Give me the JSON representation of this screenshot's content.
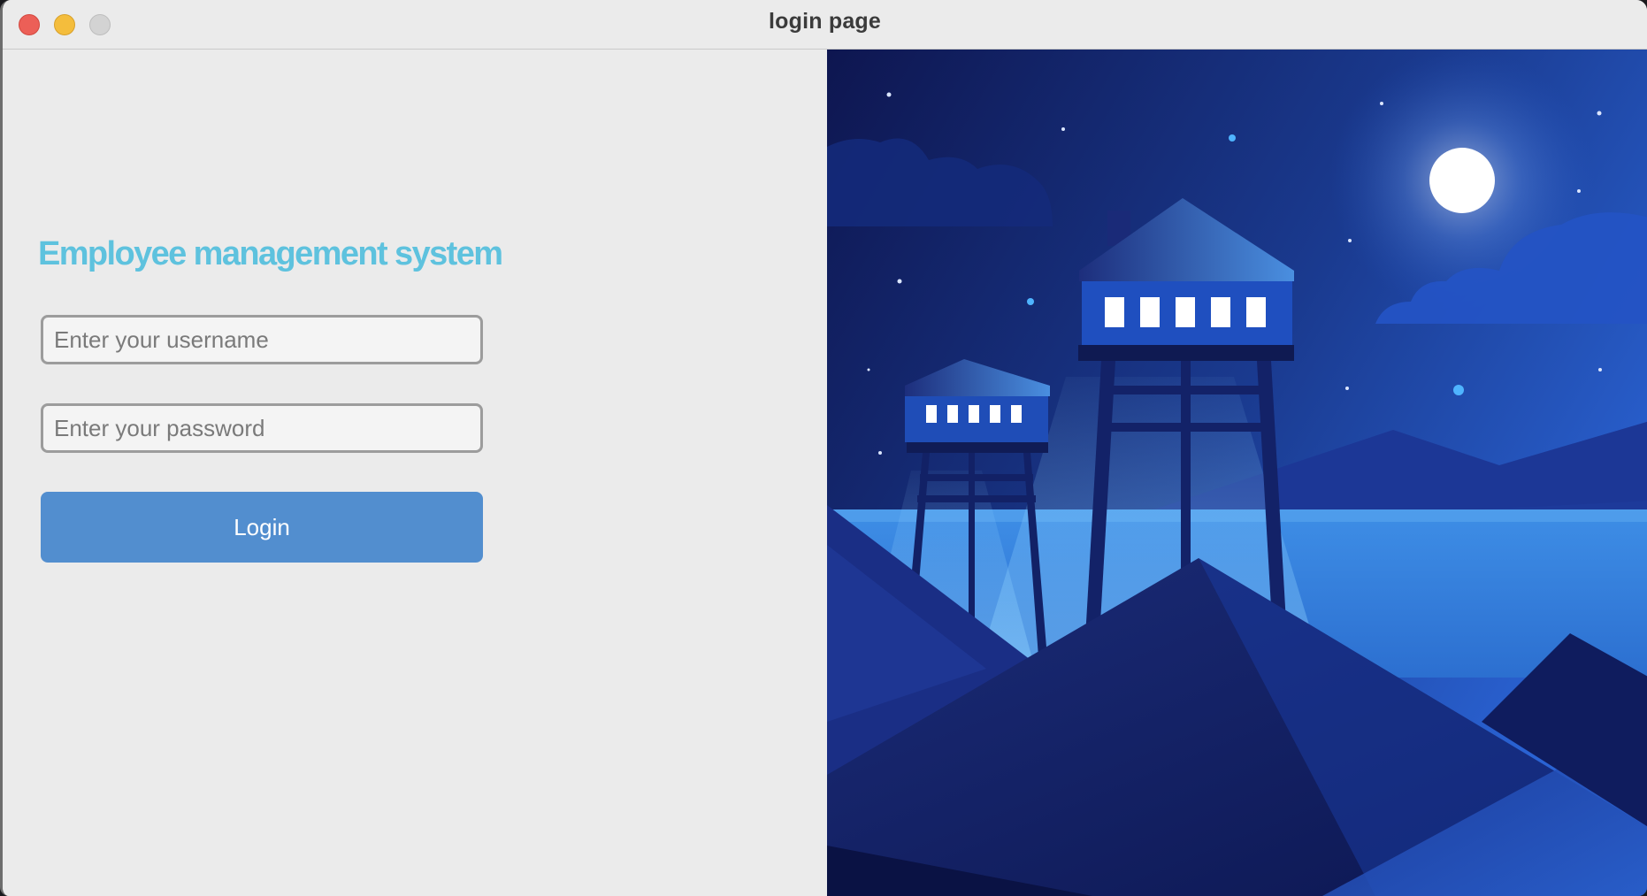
{
  "window": {
    "title": "login page"
  },
  "login_form": {
    "heading": "Employee management system",
    "username_placeholder": "Enter your username",
    "username_value": "",
    "password_placeholder": "Enter your password",
    "password_value": "",
    "login_label": "Login"
  },
  "colors": {
    "heading": "#5ec2de",
    "button": "#528ecf",
    "panel_background": "#ebebeb",
    "night_sky": "#0f1a55"
  },
  "icons": {
    "close": "close-traffic-light",
    "minimize": "minimize-traffic-light",
    "maximize": "maximize-traffic-light"
  }
}
